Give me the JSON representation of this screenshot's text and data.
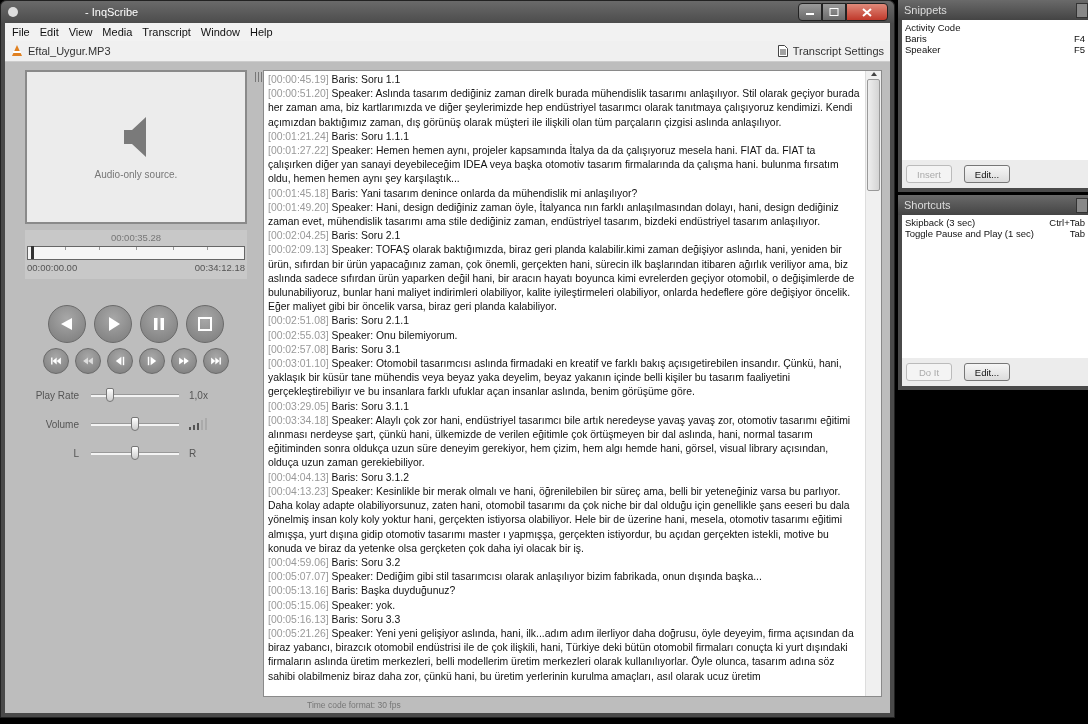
{
  "window": {
    "title": "- InqScribe",
    "menu": [
      "File",
      "Edit",
      "View",
      "Media",
      "Transcript",
      "Window",
      "Help"
    ],
    "media_file": "Eftal_Uygur.MP3",
    "settings_button": "Transcript Settings",
    "status": "Time code format: 30 fps"
  },
  "player": {
    "placeholder": "Audio-only source.",
    "current_time": "00:00:35.28",
    "start_time": "00:00:00.00",
    "end_time": "00:34:12.18",
    "position": {
      "level": 0.017
    },
    "play_rate": {
      "label": "Play Rate",
      "level": 0.22,
      "reading": "1,0x"
    },
    "volume": {
      "label": "Volume",
      "level": 0.5
    },
    "balance": {
      "left": "L",
      "right": "R",
      "level": 0.5
    }
  },
  "transcript": [
    {
      "timecode": "[00:00:45.19]",
      "text": "Baris: Soru 1.1"
    },
    {
      "timecode": "[00:00:51.20]",
      "text": "Speaker: Aslında tasarım dediğiniz zaman direlk burada mühendislik tasarımı anlaşılıyor. Stil olarak geçiyor burada her zaman ama, biz kartlarımızda ve diğer şeylerimizde hep endüstriyel tasarımcı olarak tanıtmaya çalışıyoruz kendimizi. Kendi açımızdan baktığımız zaman, dış görünüş olarak müşteri ile ilişkili olan tüm parçaların çizgisi aslında anlaşılıyor."
    },
    {
      "timecode": "[00:01:21.24]",
      "text": "Baris: Soru 1.1.1"
    },
    {
      "timecode": "[00:01:27.22]",
      "text": "Speaker: Hemen hemen aynı, projeler kapsamında İtalya da da çalışıyoruz mesela hani. FIAT da. FIAT ta çalışırken diğer yan sanayi deyebileceğim IDEA veya başka otomotiv tasarım firmalarında da çalışma hani. bulunma fırsatım oldu, hemen hemen aynı şey karşılaştık..."
    },
    {
      "timecode": "[00:01:45.18]",
      "text": "Baris:  Yani tasarım denince onlarda da mühendislik mi anlaşılıyor?"
    },
    {
      "timecode": "[00:01:49.20]",
      "text": "Speaker: Hani, design dediğiniz zaman öyle, İtalyanca nın farklı anlaşılmasından dolayı, hani, design dediğiniz zaman evet, mühendislik tasarımı ama stile dediğiniz zaman, endüstriyel tasarım, bizdeki endüstriyel tasarım anlaşılıyor."
    },
    {
      "timecode": "[00:02:04.25]",
      "text": "Baris: Soru 2.1"
    },
    {
      "timecode": "[00:02:09.13]",
      "text": "Speaker: TOFAŞ olarak baktığımızda, biraz geri planda kalabilir.kimi zaman değişiyor aslında, hani, yeniden bir ürün, sıfırdan bir ürün yapacağınız zaman, çok önemli, gerçekten hani, sürecin ilk başlarından itibaren ağırlık veriliyor ama, biz aslında sadece sıfırdan ürün yaparken değil hani, bir aracın hayatı boyunca kimi evrelerden geçiyor otomobil, o değişimlerde de bulunabiliyoruz, bunlar hani maliyet indirimleri olabiliyor, kalite iyileştirmeleri olabiliyor, onlarda hedeflere göre değişiyor öncelik. Eğer maliyet gibi bir öncelik varsa, biraz geri planda kalabiliyor."
    },
    {
      "timecode": "[00:02:51.08]",
      "text": "Baris: Soru 2.1.1"
    },
    {
      "timecode": "[00:02:55.03]",
      "text": "Speaker: Onu bilemiyorum."
    },
    {
      "timecode": "[00:02:57.08]",
      "text": "Baris: Soru 3.1"
    },
    {
      "timecode": "[00:03:01.10]",
      "text": "Speaker: Otomobil tasarımcısı aslında firmadaki en kreatif ve farklı bakış açısıgetirebilen insandır. Çünkü, hani, yaklaşık bir küsür tane mühendis veya beyaz yaka deyelim, beyaz yakanın içinde  belli kişiler bu tasarım faaliyetini gerçekleştirebiliyır ve bu insanlara farklı ufuklar açan insanlar aslında, benim görüşüme göre."
    },
    {
      "timecode": "[00:03:29.05]",
      "text": "Baris: Soru 3.1.1"
    },
    {
      "timecode": "[00:03:34.18]",
      "text": "Speaker: Alaylı çok zor hani, endüstriyel tasarımcı bile artık neredeyse yavaş yavaş zor, otomotiv tasarımı eğitimi alınması nerdeyse şart, çünkü hani, ülkemizde de verilen eğitimle çok örtüşmeyen bir dal aslında, hani, normal tasarım eğitiminden sonra oldukça uzun süre deneyim gerekiyor, hem çizim, hem algı hemde hani, görsel, visual library açısından, olduça uzun zaman gerekiebiliyor."
    },
    {
      "timecode": "[00:04:04.13]",
      "text": "Baris: Soru 3.1.2"
    },
    {
      "timecode": "[00:04:13.23]",
      "text": "Speaker: Kesinlikle bir merak olmalı ve hani, öğrenilebilen bir süreç ama, belli bir yeteneğiniz varsa bu parlıyor. Daha kolay adapte olabiliyorsunuz, zaten hani, otomobil tasarımı da çok niche bir dal olduğu için genellikle şans eeseri bu dala yönelmiş insan koly koly yoktur hani, gerçekten istiyorsa olabiliyor. Hele bir de üzerine hani, mesela, otomotiv tasarımı eğitimi almışşa, yurt dışına gidip otomotiv tasarımı master ı yapmışşa, gerçekten istiyordur, bu açıdan gerçekten istekli, motive bu konuda ve biraz da yetenke olsa gerçketen çok daha iyi olacak bir iş."
    },
    {
      "timecode": "[00:04:59.06]",
      "text": "Baris: Soru 3.2"
    },
    {
      "timecode": "[00:05:07.07]",
      "text": "Speaker: Dediğim gibi stil tasarımcısı olarak anlaşılıyor bizim fabrikada, onun dışında başka..."
    },
    {
      "timecode": "[00:05:13.16]",
      "text": "Baris: Başka duyduğunuz?"
    },
    {
      "timecode": "[00:05:15.06]",
      "text": "Speaker: yok."
    },
    {
      "timecode": "[00:05:16.13]",
      "text": "Baris: Soru 3.3"
    },
    {
      "timecode": "[00:05:21.26]",
      "text": "Speaker: Yeni yeni gelişiyor aslında, hani, ilk...adım adım ilerliyor daha doğrusu, öyle deyeyim, firma açısından da biraz yabancı, birazcık otomobil endüstrisi ile de çok ilişkili, hani, Türkiye deki bütün otomobil firmaları conuçta ki yurt dışındaki firmaların aslında üretim merkezleri, belli modellerim üretim merkezleri olarak kullanılıyorlar. Öyle olunca, tasarım adına söz sahibi olabilmeniz biraz daha zor, çünkü hani, bu üretim yerlerinin kurulma  amaçları, asıl olarak ucuz üretim"
    }
  ],
  "snippets": {
    "title": "Snippets",
    "items": [
      {
        "label": "Activity Code"
      },
      {
        "label": "Baris",
        "key": "F4"
      },
      {
        "label": "Speaker",
        "key": "F5"
      }
    ],
    "buttons": [
      {
        "label": "Insert",
        "disabled": true
      },
      {
        "label": "Edit...",
        "disabled": false
      }
    ]
  },
  "shortcuts": {
    "title": "Shortcuts",
    "items": [
      {
        "label": "Skipback (3 sec)",
        "key": "Ctrl+Tab"
      },
      {
        "label": "Toggle Pause and Play (1 sec)",
        "key": "Tab"
      }
    ],
    "buttons": [
      {
        "label": "Do It",
        "disabled": true
      },
      {
        "label": "Edit...",
        "disabled": false
      }
    ]
  }
}
